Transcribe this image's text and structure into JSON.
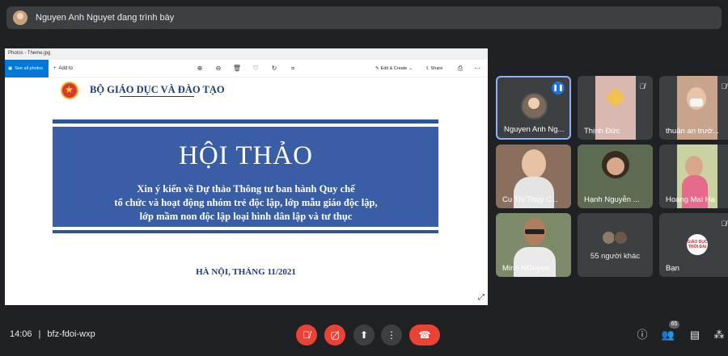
{
  "presenter_banner": "Nguyen Anh Nguyet đang trình bày",
  "window": {
    "title": "Photos - Theme.jpg",
    "see_all": "See all photos",
    "add_to": "Add to",
    "edit_create": "Edit & Create",
    "share": "Share"
  },
  "slide": {
    "ministry": "BỘ GIÁO DỤC VÀ ĐÀO TẠO",
    "title": "HỘI THẢO",
    "subtitle_lines": [
      "Xin ý kiến về Dự thảo Thông tư ban hành Quy chế",
      "tổ chức và hoạt động nhóm trẻ độc lập, lớp mẫu giáo độc lập,",
      "lớp mầm non độc lập loại hình dân lập và tư thục"
    ],
    "footer": "HÀ NỘI, THÁNG 11/2021"
  },
  "participants": [
    {
      "name": "Nguyen Anh Ng...",
      "active": true
    },
    {
      "name": "Thịnh Đức"
    },
    {
      "name": "thuận an trườ..."
    },
    {
      "name": "Cu Thi Thuy C..."
    },
    {
      "name": "Hạnh Nguyễn ..."
    },
    {
      "name": "Hoang Mai Ha"
    },
    {
      "name": "Minh NGuyen"
    },
    {
      "name": "55 người khác"
    },
    {
      "name": "Bạn"
    }
  ],
  "gd_logo": "GIÁO DỤC THỜI ĐẠI",
  "meeting": {
    "time": "14:06",
    "separator": "|",
    "code": "bfz-fdoi-wxp",
    "participant_count": "65"
  },
  "icons": {
    "mic_off": "mic-off-icon",
    "cam_off": "camera-off-icon",
    "present": "present-icon",
    "more": "more-icon",
    "hangup": "hangup-icon"
  },
  "colors": {
    "background": "#202124",
    "tile": "#3c4043",
    "accent_red": "#ea4335",
    "active_border": "#8ab4f8",
    "slide_blue": "#3a5ea6"
  }
}
